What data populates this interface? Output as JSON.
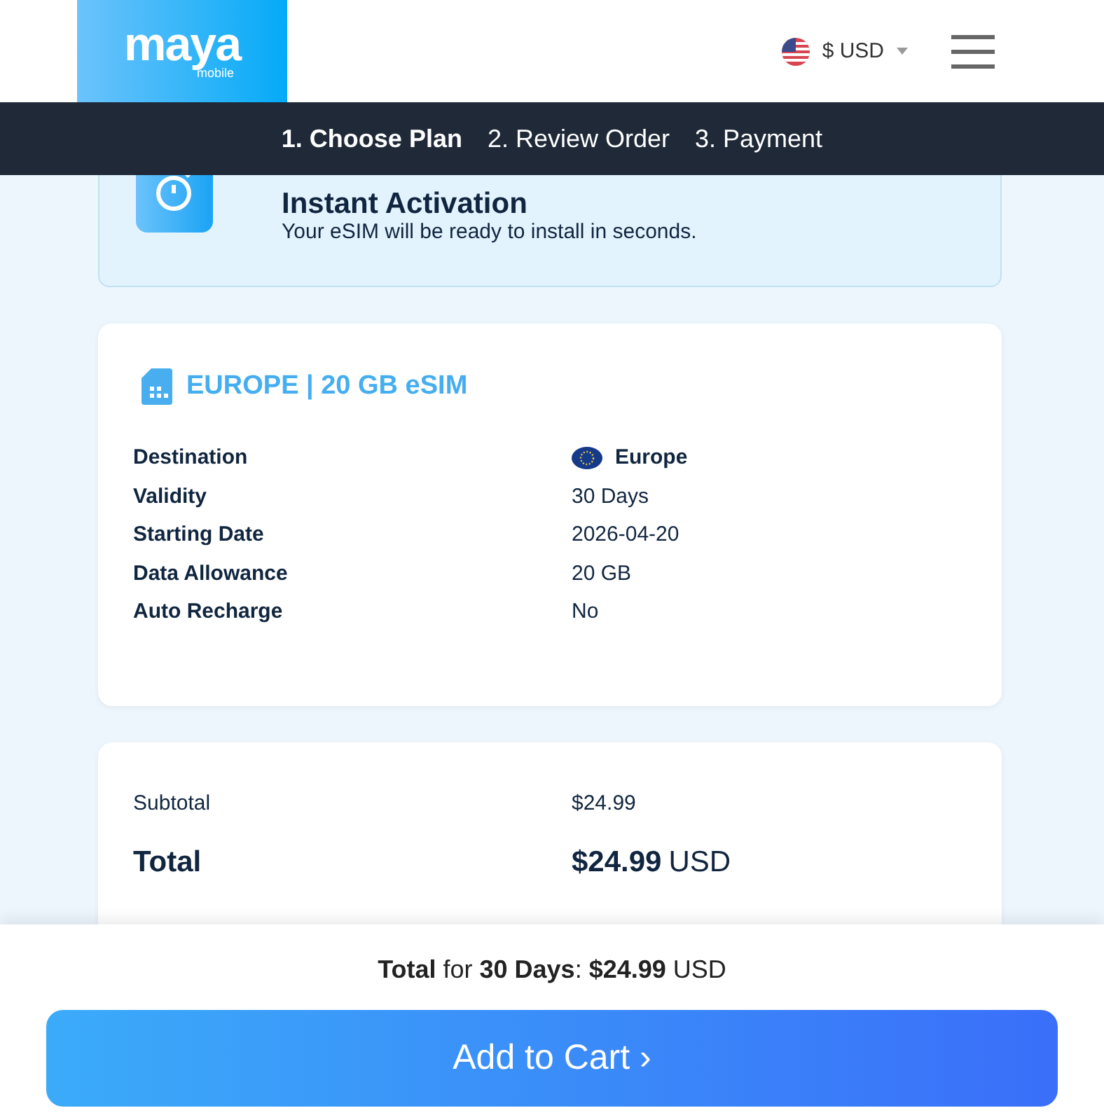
{
  "header": {
    "logo": {
      "name": "maya",
      "tagline": "mobile"
    },
    "currency": "$ USD"
  },
  "steps": [
    {
      "label": "1. Choose Plan",
      "selected": true
    },
    {
      "label": "2. Review Order",
      "selected": false
    },
    {
      "label": "3. Payment",
      "selected": false
    }
  ],
  "activation": {
    "title": "Instant Activation",
    "text": "Your eSIM will be ready to install in seconds."
  },
  "plan": {
    "title": "EUROPE | 20 GB eSIM",
    "details": [
      {
        "label": "Destination",
        "value": "Europe",
        "kind": "flag"
      },
      {
        "label": "Validity",
        "value": "30 Days",
        "kind": "text"
      },
      {
        "label": "Starting Date",
        "value": "2026-04-20",
        "kind": "text"
      },
      {
        "label": "Data Allowance",
        "value": "20 GB",
        "kind": "text"
      },
      {
        "label": "Auto Recharge",
        "value": "No",
        "kind": "text"
      }
    ]
  },
  "summary": {
    "subtotal_label": "Subtotal",
    "subtotal": "$24.99",
    "total_label": "Total",
    "total": "$24.99",
    "currency": "USD"
  },
  "footer": {
    "total_line": "**Total** for **30 Days**:  **$24.99** USD",
    "button": "Add to Cart ›"
  }
}
